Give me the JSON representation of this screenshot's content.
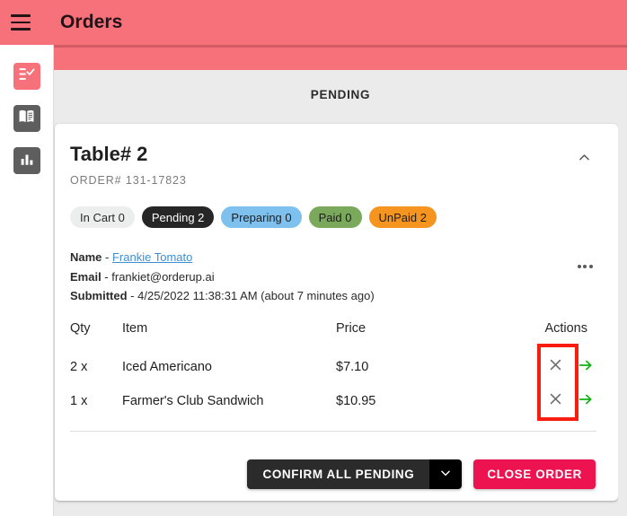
{
  "topbar": {
    "menu_icon": "hamburger-icon",
    "title": "Orders"
  },
  "sidebar": {
    "items": [
      {
        "icon": "checklist-icon",
        "name": "orders",
        "active": true
      },
      {
        "icon": "menu-book-icon",
        "name": "menu",
        "active": false
      },
      {
        "icon": "bar-chart-icon",
        "name": "reports",
        "active": false
      }
    ]
  },
  "main": {
    "section_label": "PENDING"
  },
  "card": {
    "title": "Table# 2",
    "order_number": "ORDER# 131-17823",
    "collapse_icon": "chevron-up-icon",
    "more_icon": "more-horizontal-icon",
    "chips": [
      {
        "label": "In Cart 0",
        "bg": "#eceded",
        "fg": "#2a2a2a"
      },
      {
        "label": "Pending 2",
        "bg": "#262626",
        "fg": "#ffffff"
      },
      {
        "label": "Preparing 0",
        "bg": "#7ec0ee",
        "fg": "#1d1d1d"
      },
      {
        "label": "Paid 0",
        "bg": "#7aa95c",
        "fg": "#1d1d1d"
      },
      {
        "label": "UnPaid 2",
        "bg": "#f5941e",
        "fg": "#1d1d1d"
      }
    ],
    "customer": {
      "name_label": "Name",
      "name_sep": " - ",
      "name_value": "Frankie Tomato",
      "email_label": "Email",
      "email_sep": " - ",
      "email_value": "frankiet@orderup.ai",
      "submitted_label": "Submitted",
      "submitted_sep": " - ",
      "submitted_value": "4/25/2022 11:38:31 AM (about 7 minutes ago)"
    },
    "table": {
      "columns": [
        "Qty",
        "Item",
        "Price",
        "Actions"
      ],
      "rows": [
        {
          "qty": "2 x",
          "item": "Iced Americano",
          "price": "$7.10",
          "cancel_icon": "close-icon",
          "advance_icon": "arrow-right-icon"
        },
        {
          "qty": "1 x",
          "item": "Farmer's Club Sandwich",
          "price": "$10.95",
          "cancel_icon": "close-icon",
          "advance_icon": "arrow-right-icon"
        }
      ]
    },
    "footer": {
      "confirm_label": "CONFIRM ALL PENDING",
      "confirm_dropdown_icon": "chevron-down-icon",
      "close_label": "CLOSE ORDER"
    }
  },
  "annotation": {
    "name": "highlight-box",
    "color": "#f91d10"
  },
  "colors": {
    "brand": "#f7717a",
    "brand_dark": "#d35b63",
    "page_bg": "#ebebeb",
    "accent_close": "#ec1350",
    "link": "#3d8fd4",
    "arrow_green": "#13b313"
  }
}
